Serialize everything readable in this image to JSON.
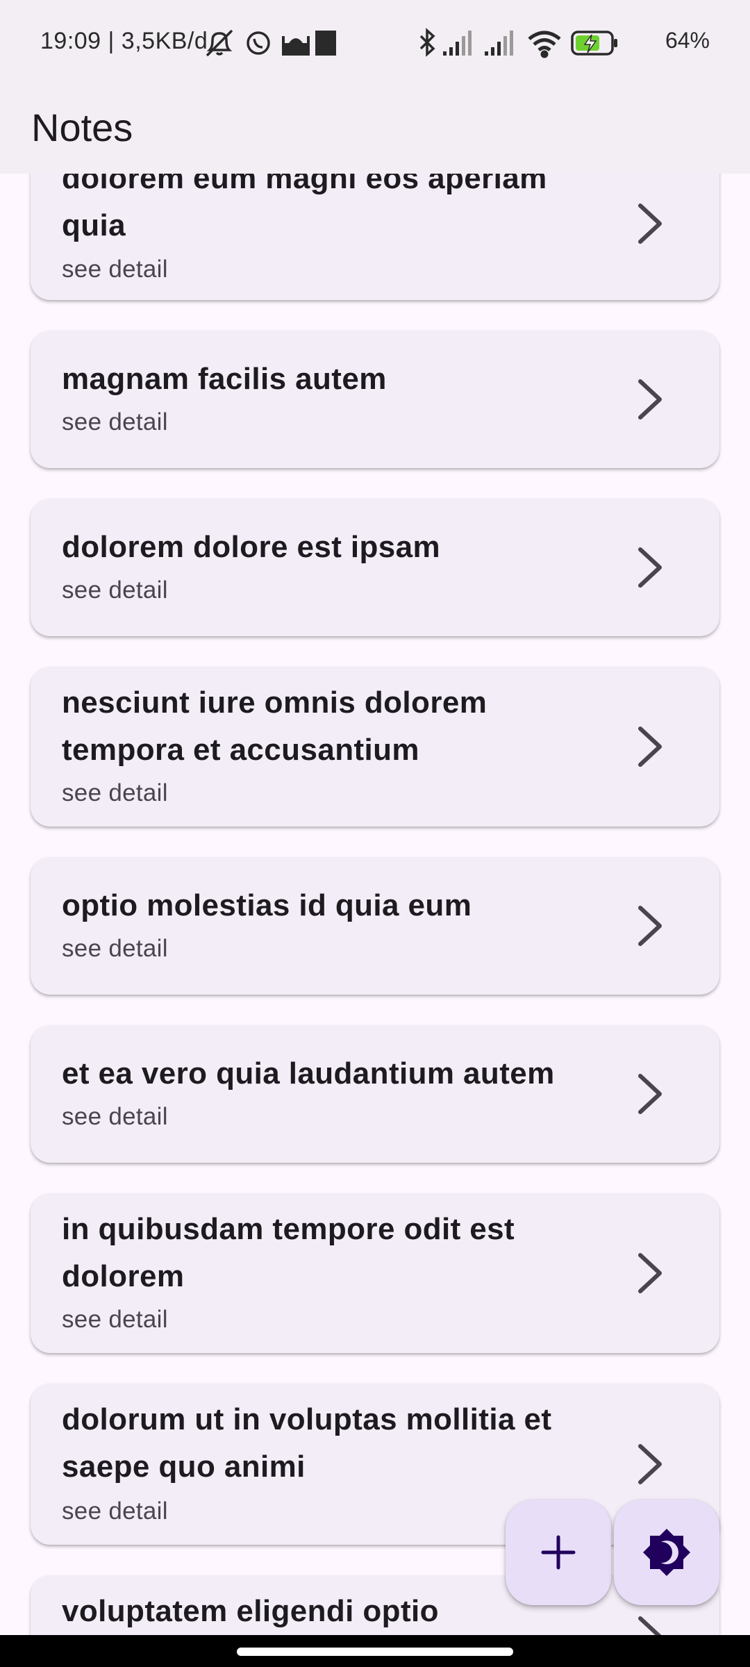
{
  "status_bar": {
    "time_text": "19:09 | 3,5KB/d",
    "battery_percent": "64%",
    "icons": [
      "muted-bell-icon",
      "whatsapp-icon",
      "mosque-icon",
      "app-square-icon",
      "bluetooth-icon",
      "signal-icon",
      "signal-icon",
      "wifi-icon",
      "battery-charging-icon"
    ]
  },
  "app_bar": {
    "title": "Notes"
  },
  "notes": [
    {
      "title": "dolorem eum magni eos aperiam quia",
      "subtitle": "see detail"
    },
    {
      "title": "magnam facilis autem",
      "subtitle": "see detail"
    },
    {
      "title": "dolorem dolore est ipsam",
      "subtitle": "see detail"
    },
    {
      "title": "nesciunt iure omnis dolorem tempora et accusantium",
      "subtitle": "see detail"
    },
    {
      "title": "optio molestias id quia eum",
      "subtitle": "see detail"
    },
    {
      "title": "et ea vero quia laudantium autem",
      "subtitle": "see detail"
    },
    {
      "title": "in quibusdam tempore odit est dolorem",
      "subtitle": "see detail"
    },
    {
      "title": "dolorum ut in voluptas mollitia et saepe quo animi",
      "subtitle": "see detail"
    },
    {
      "title": "voluptatem eligendi optio"
    }
  ],
  "fabs": {
    "add_icon": "plus-icon",
    "theme_icon": "theme-toggle-icon"
  },
  "colors": {
    "background": "#fef7ff",
    "card": "#f3edf7",
    "fab": "#e8def8",
    "fab_icon": "#21005d",
    "chevron": "#49454f"
  }
}
